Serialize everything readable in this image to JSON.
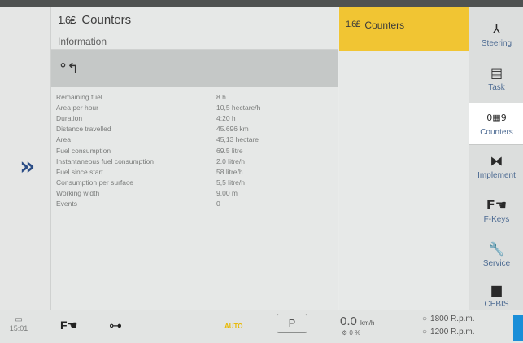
{
  "header": {
    "title": "Counters",
    "subtitle": "Information",
    "info_icon": "back-arrow-icon"
  },
  "counters": [
    {
      "label": "Remaining fuel",
      "value": "8 h"
    },
    {
      "label": "Area per hour",
      "value": "10,5 hectare/h"
    },
    {
      "label": "Duration",
      "value": "4:20 h"
    },
    {
      "label": "Distance travelled",
      "value": "45.696 km"
    },
    {
      "label": "Area",
      "value": "45,13 hectare"
    },
    {
      "label": "Fuel consumption",
      "value": "69.5 litre"
    },
    {
      "label": "Instantaneous fuel consumption",
      "value": "2.0 litre/h"
    },
    {
      "label": "Fuel since start",
      "value": "58 litre/h"
    },
    {
      "label": "Consumption per surface",
      "value": "5,5 litre/h"
    },
    {
      "label": "Working width",
      "value": "9.00 m"
    },
    {
      "label": "Events",
      "value": "0"
    }
  ],
  "right_tab": {
    "label": "Counters"
  },
  "sidebar": {
    "items": [
      {
        "label": "Steering",
        "icon": "steering-icon"
      },
      {
        "label": "Task",
        "icon": "clipboard-icon"
      },
      {
        "label": "Counters",
        "icon": "counters-icon"
      },
      {
        "label": "Implement",
        "icon": "implement-icon"
      },
      {
        "label": "F-Keys",
        "icon": "f-keys-icon"
      },
      {
        "label": "Service",
        "icon": "wrench-icon"
      },
      {
        "label": "CEBIS",
        "icon": "monitor-icon"
      }
    ]
  },
  "status_bar": {
    "time": "15:01",
    "fkey_label": "F",
    "auto_label": "AUTO",
    "park_label": "P",
    "speed_value": "0.0",
    "speed_unit": "km/h",
    "slip_value": "0 %",
    "rpm_top": "1800 R.p.m.",
    "rpm_bottom": "1200 R.p.m."
  },
  "colors": {
    "accent_yellow": "#f1c533",
    "nav_blue": "#2b4d86",
    "auto_yellow": "#e8b800",
    "indicator_blue": "#1a8ed8"
  }
}
